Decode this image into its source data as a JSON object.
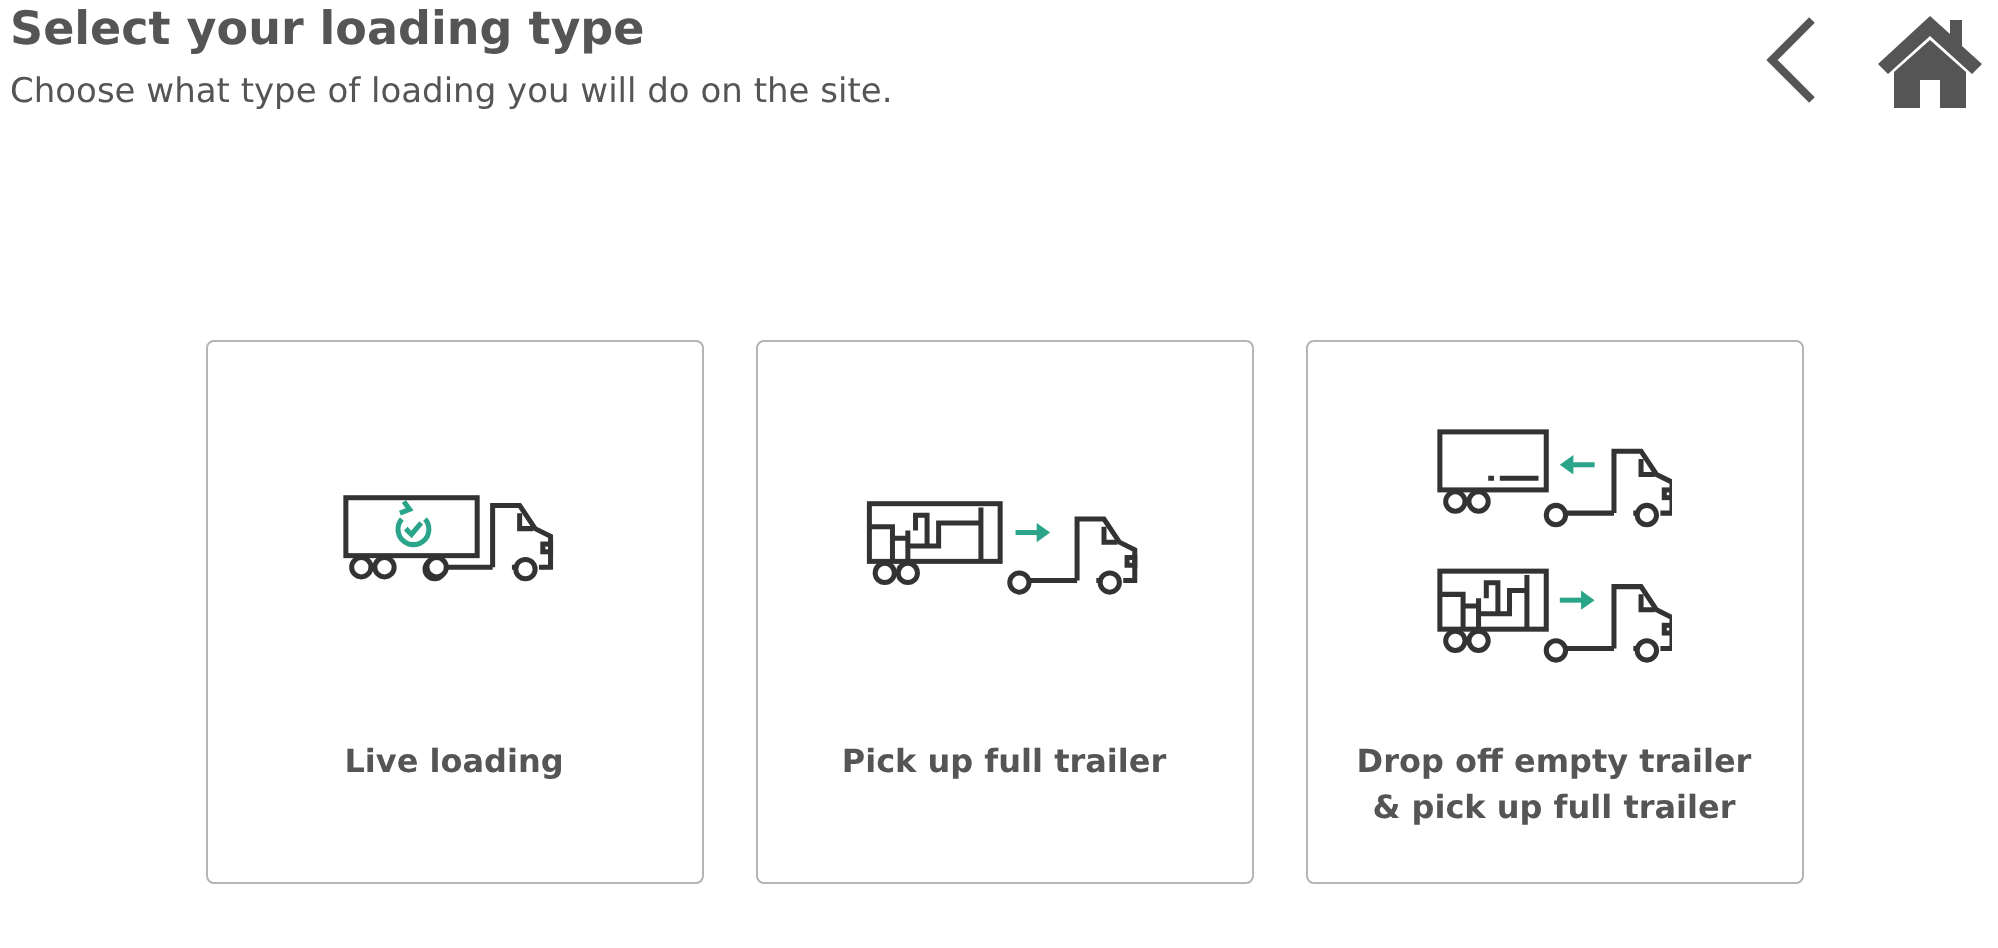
{
  "title": "Select your loading type",
  "subtitle": "Choose what type of loading you will do on the site.",
  "options": [
    {
      "kind": "live",
      "label": "Live loading"
    },
    {
      "kind": "pickup",
      "label": "Pick up full trailer"
    },
    {
      "kind": "swap",
      "label": "Drop off empty trailer & pick up full trailer"
    }
  ]
}
